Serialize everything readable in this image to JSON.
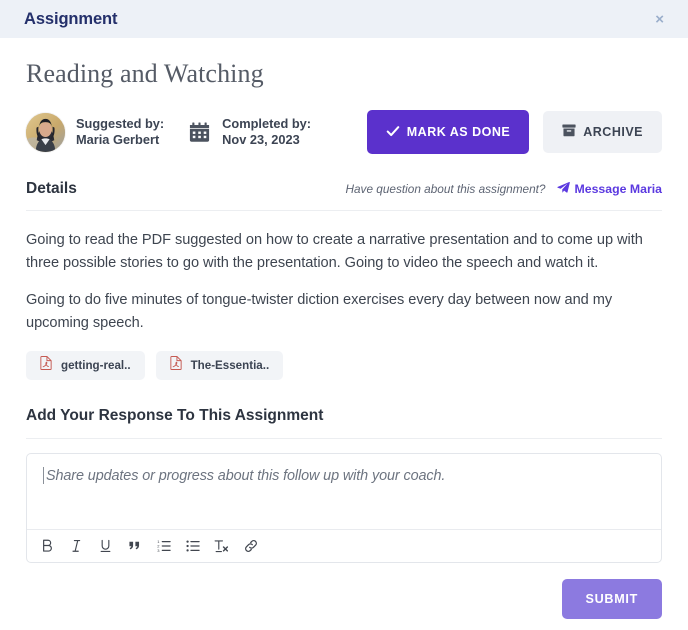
{
  "header": {
    "title": "Assignment",
    "close_label": "×"
  },
  "assignment": {
    "title": "Reading and Watching",
    "suggested_by_label": "Suggested by:",
    "suggested_by_name": "Maria Gerbert",
    "completed_by_label": "Completed by:",
    "completed_by_date": "Nov 23, 2023"
  },
  "actions": {
    "mark_done_label": "MARK AS DONE",
    "archive_label": "ARCHIVE"
  },
  "details": {
    "heading": "Details",
    "question_text": "Have question about this assignment?",
    "message_link_label": "Message Maria",
    "paragraphs": [
      "Going to read the PDF suggested on how to create a narrative presentation and to come up with three possible stories to go with the presentation. Going to video the speech and watch it.",
      "Going to do five minutes of tongue-twister diction exercises every day between now and my upcoming speech."
    ],
    "attachments": [
      {
        "name": "getting-real..",
        "icon": "pdf-file-icon"
      },
      {
        "name": "The-Essentia..",
        "icon": "pdf-file-icon"
      }
    ]
  },
  "response": {
    "heading": "Add Your Response To This Assignment",
    "placeholder": "Share updates or progress about this follow up with your coach.",
    "value": "",
    "toolbar": [
      {
        "name": "bold",
        "label": "B"
      },
      {
        "name": "italic",
        "label": "I"
      },
      {
        "name": "underline",
        "label": "U"
      },
      {
        "name": "blockquote",
        "label": "”"
      },
      {
        "name": "ordered-list",
        "label": ""
      },
      {
        "name": "unordered-list",
        "label": ""
      },
      {
        "name": "clear-formatting",
        "label": "Tx"
      },
      {
        "name": "link",
        "label": ""
      }
    ],
    "submit_label": "SUBMIT"
  },
  "colors": {
    "header_bg": "#edf1f7",
    "header_title": "#24306b",
    "primary_purple": "#5b31cc",
    "link_purple": "#5b39e0",
    "submit_purple": "#8c7ae0",
    "archive_bg": "#eff1f5",
    "pdf_icon_red": "#c55a52",
    "body_text": "#3e4550"
  }
}
